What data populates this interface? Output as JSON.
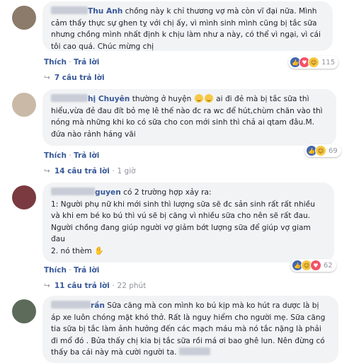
{
  "comments": [
    {
      "name_rest": "Thu Anh",
      "text": "chồng này k chỉ thương vợ mà còn vĩ đại nữa. Mình cảm thấy thực sự ghen tỵ với chị ấy, vì mình sinh mình cũng bị tắc sữa nhưng chồng mình nhất định k chịu làm như a này, có thể vì ngại, vì cái tôi cao quá. Chúc mừng chị",
      "like_label": "Thích",
      "reply_label": "Trả lời",
      "reaction_count": "115",
      "replies_label": "7 câu trả lời"
    },
    {
      "name_rest": "hị Chuyên",
      "text_before_emoji": "thường ở huyện",
      "text_after_emoji": "ai đi đẻ mà bị tắc sữa thì hiểu,vừa đẻ đau đít bỏ mẹ lê thế nào đc ra wc để hút,chùm chăn vào thì nóng mà những khi ko có sữa cho con mới sinh thì chả ai qtam đâu.M. đứa nào rảnh háng vãi",
      "like_label": "Thích",
      "reply_label": "Trả lời",
      "reaction_count": "69",
      "replies_label": "14 câu trả lời",
      "replies_time": "1 giờ"
    },
    {
      "name_rest": "guyen",
      "text_lead": "có 2 trường hợp xảy ra:",
      "text_body": "1: Người phụ nữ khi mới sinh thì lượng sữa sẽ đc sản sinh rất rất nhiều và khi em bé ko bú thì vú sẽ bị căng vì nhiều sữa cho nên sẽ rất đau. Người chồng đang giúp người vợ giảm bớt lượng sữa để giúp vợ giam đau",
      "text_tail": "2. nó thèm",
      "like_label": "Thích",
      "reply_label": "Trả lời",
      "reaction_count": "62",
      "replies_label": "11 câu trả lời",
      "replies_time": "22 phút"
    },
    {
      "name_rest": "rần",
      "text": "Sữa căng mà con mình ko bú kịp mà ko hút ra dược là bị áp xe luôn chóng mặt khó thở. Rất là nguy hiểm cho người mẹ. Sữa căng tia sữa bị tắc làm ảnh hưởng đến các mạch máu mà nó tắc nặng là phải đi mổ đó . Bửa thấy chị kia bị tắc sữa rồi má ơi bao ghê lun. Nên đừng có thấy ba cái này mà cười người ta."
    }
  ]
}
